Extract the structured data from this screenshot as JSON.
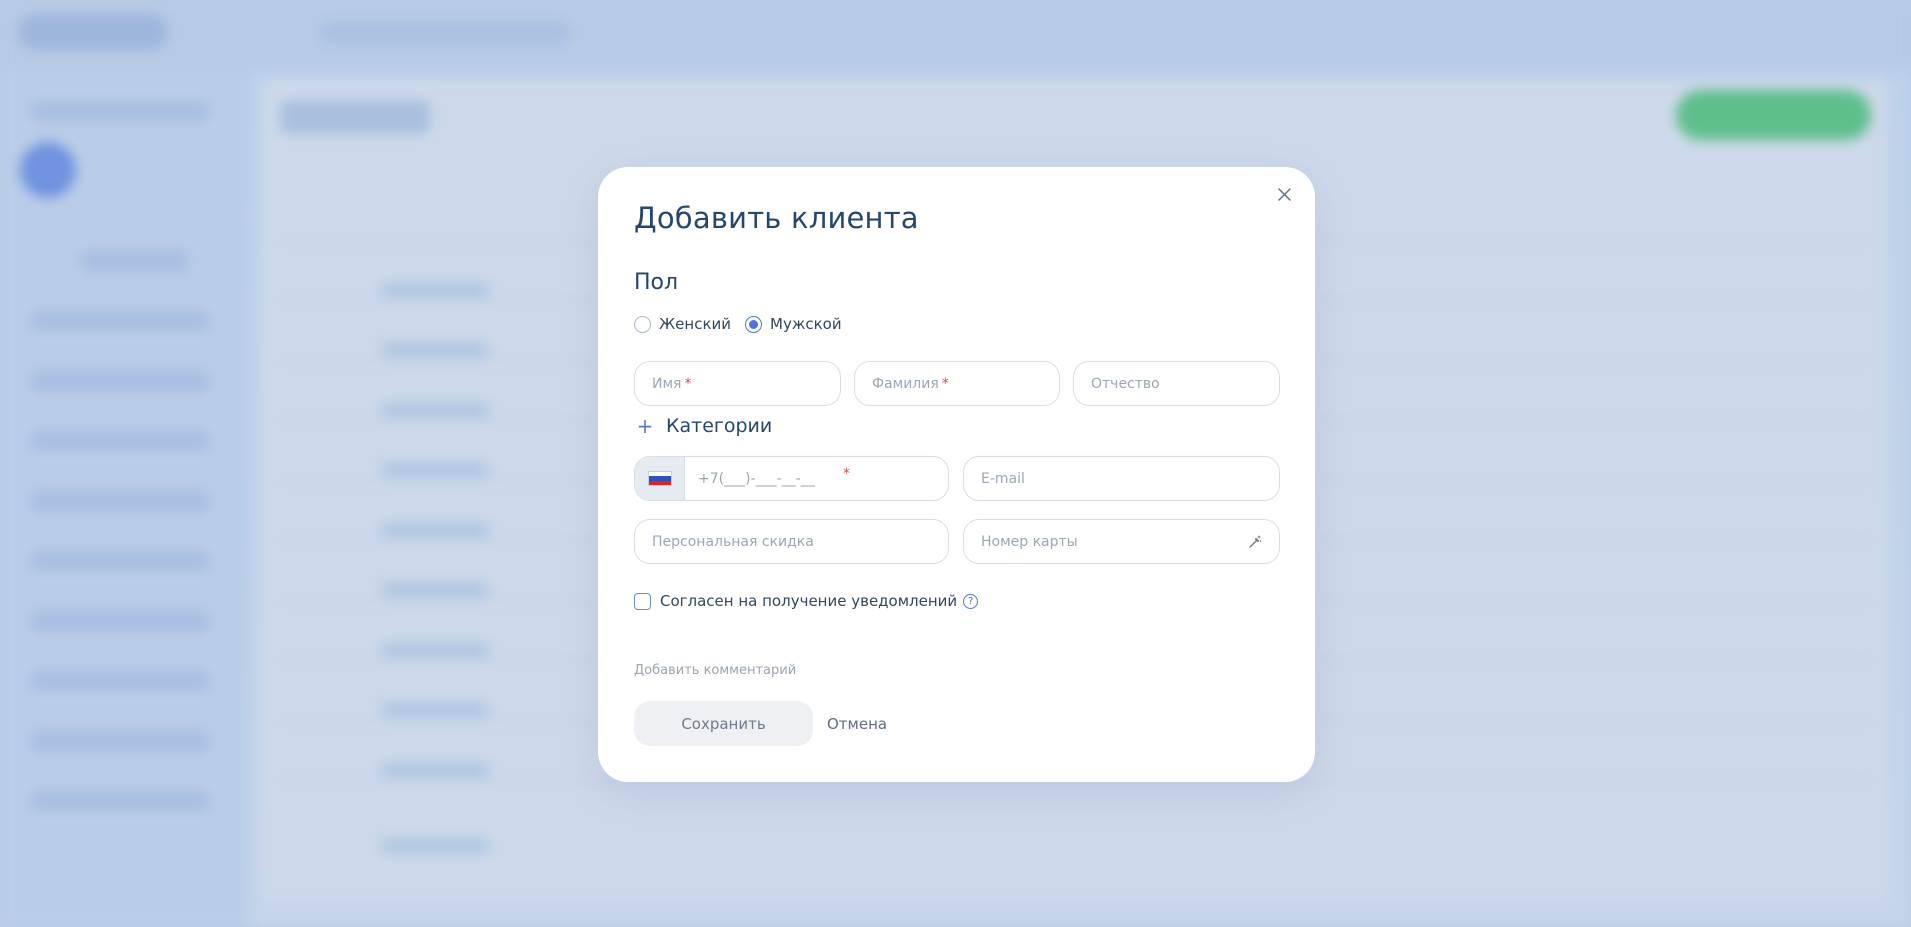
{
  "modal": {
    "title": "Добавить клиента",
    "gender_label": "Пол",
    "gender_options": [
      {
        "label": "Женский",
        "selected": false
      },
      {
        "label": "Мужской",
        "selected": true
      }
    ],
    "first_name_placeholder": "Имя",
    "last_name_placeholder": "Фамилия",
    "middle_name_placeholder": "Отчество",
    "required_mark": "*",
    "categories_label": "Категории",
    "phone": {
      "country_flag": "russia-flag-icon",
      "placeholder": "+7(___)-___-__-__"
    },
    "email_placeholder": "E-mail",
    "discount_placeholder": "Персональная скидка",
    "card_number_placeholder": "Номер карты",
    "consent_label": "Согласен на получение уведомлений",
    "consent_checked": false,
    "help_glyph": "?",
    "add_comment_label": "Добавить комментарий",
    "save_label": "Сохранить",
    "cancel_label": "Отмена"
  },
  "colors": {
    "accent": "#4f72e0",
    "title": "#27466e",
    "required": "#e24c4c",
    "overlay": "#b9cbe4"
  }
}
